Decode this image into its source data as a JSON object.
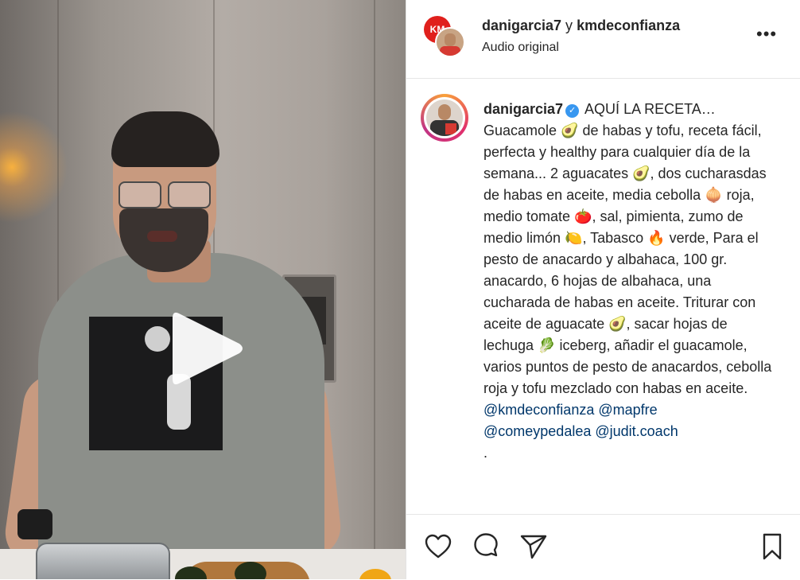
{
  "post": {
    "authors_line": {
      "author1": "danigarcia7",
      "connector": " y ",
      "author2": "kmdeconfianza"
    },
    "audio_label": "Audio original",
    "more_icon": "•••"
  },
  "caption": {
    "username": "danigarcia7",
    "text": " AQUÍ LA RECETA… Guacamole 🥑 de habas y tofu, receta fácil, perfecta y healthy para cualquier día de la semana... 2 aguacates 🥑, dos cucharasdas de habas en aceite, media cebolla 🧅 roja, medio tomate 🍅, sal, pimienta, zumo de medio limón 🍋, Tabasco 🔥 verde, Para el pesto de anacardo y albahaca, 100 gr. anacardo, 6 hojas de albahaca, una cucharada de habas en aceite. Triturar con aceite de aguacate 🥑, sacar hojas de lechuga 🥬 iceberg, añadir el guacamole, varios puntos de pesto de anacardos, cebolla roja y tofu mezclado con habas en aceite.",
    "mentions": [
      "@kmdeconfianza",
      "@mapfre",
      "@comeypedalea",
      "@judit.coach"
    ],
    "trailing": "."
  },
  "icons": {
    "play": "play-icon",
    "like": "heart-icon",
    "comment": "comment-icon",
    "share": "share-icon",
    "save": "bookmark-icon",
    "verified": "verified-badge-icon",
    "more": "more-options-icon"
  },
  "colors": {
    "text": "#262626",
    "mention": "#00376b",
    "verified": "#3897f0",
    "border": "#e6e6e6"
  }
}
